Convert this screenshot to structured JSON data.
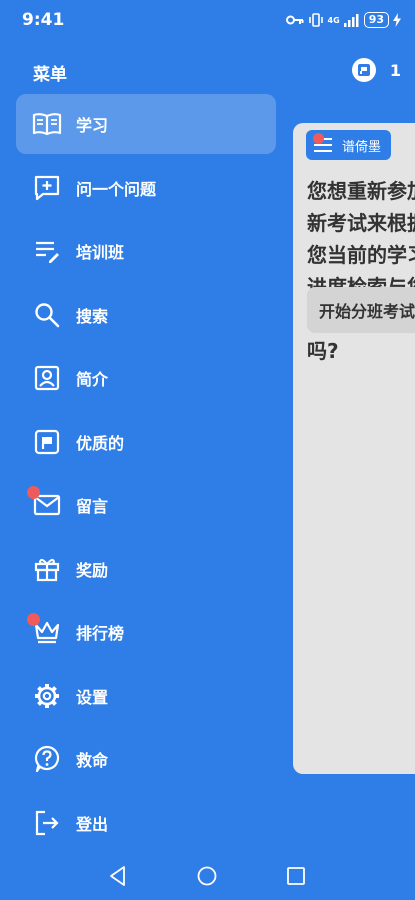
{
  "status_bar": {
    "time": "9:41",
    "battery": "93",
    "network": "4G"
  },
  "header": {
    "title": "菜单",
    "notification_count": "1"
  },
  "menu": {
    "items": [
      {
        "label": "学习",
        "icon": "book-open-icon"
      },
      {
        "label": "问一个问题",
        "icon": "chat-plus-icon"
      },
      {
        "label": "培训班",
        "icon": "list-pencil-icon"
      },
      {
        "label": "搜索",
        "icon": "search-icon"
      },
      {
        "label": "简介",
        "icon": "profile-icon"
      },
      {
        "label": "优质的",
        "icon": "premium-icon"
      },
      {
        "label": "留言",
        "icon": "mail-icon"
      },
      {
        "label": "奖励",
        "icon": "gift-icon"
      },
      {
        "label": "排行榜",
        "icon": "crown-icon"
      },
      {
        "label": "设置",
        "icon": "gear-icon"
      },
      {
        "label": "救命",
        "icon": "help-icon"
      },
      {
        "label": "登出",
        "icon": "logout-icon"
      }
    ]
  },
  "content": {
    "chip_label": "谱倚墨",
    "question": "您想重新参加新考试来根据您当前的学习进度检索与您当前学习主题吗?",
    "start_button": "开始分班考试"
  },
  "colors": {
    "background": "#2f7de6",
    "accent_dot": "#ef5b5b",
    "card": "#e4e4e4"
  }
}
